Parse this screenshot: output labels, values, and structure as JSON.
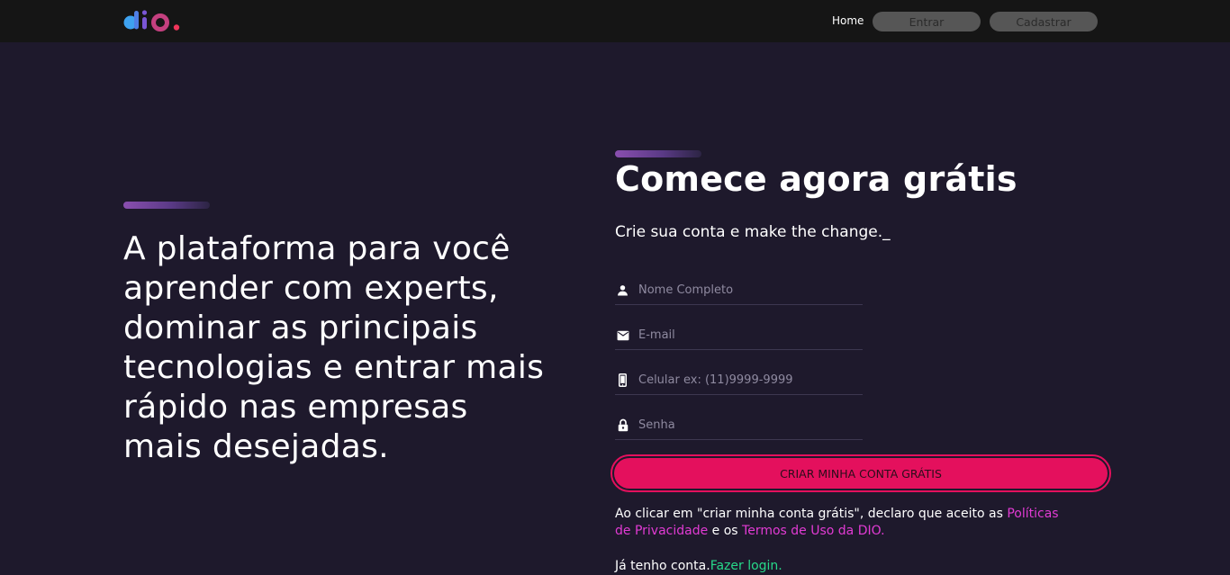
{
  "brand": {
    "logo_text": "dio."
  },
  "nav": {
    "home": "Home",
    "signin": "Entrar",
    "signup": "Cadastrar"
  },
  "hero": {
    "headline": "A plataforma para você aprender com experts, dominar as principais tecnologias e entrar mais rápido nas empresas mais desejadas."
  },
  "form": {
    "title": "Comece agora grátis",
    "subtitle": "Crie sua conta e make the change._",
    "fields": [
      {
        "icon": "person-icon",
        "placeholder": "Nome Completo",
        "value": ""
      },
      {
        "icon": "mail-icon",
        "placeholder": "E-mail",
        "value": ""
      },
      {
        "icon": "phone-icon",
        "placeholder": "Celular ex: (11)9999-9999",
        "value": ""
      },
      {
        "icon": "lock-icon",
        "placeholder": "Senha",
        "value": ""
      }
    ],
    "submit": "CRIAR MINHA CONTA GRÁTIS",
    "terms_prefix": "Ao clicar em \"criar minha conta grátis\", declaro que aceito as ",
    "privacy_link": "Políticas de Privacidade",
    "terms_middle": " e os ",
    "terms_link": "Termos de Uso da DIO.",
    "login_prefix": "Já tenho conta.",
    "login_link": "Fazer login."
  },
  "colors": {
    "background": "#1e192c",
    "topbar": "#151515",
    "accent_pink": "#e4105d",
    "link_pink": "#e23bd4",
    "link_green": "#27d98a"
  }
}
